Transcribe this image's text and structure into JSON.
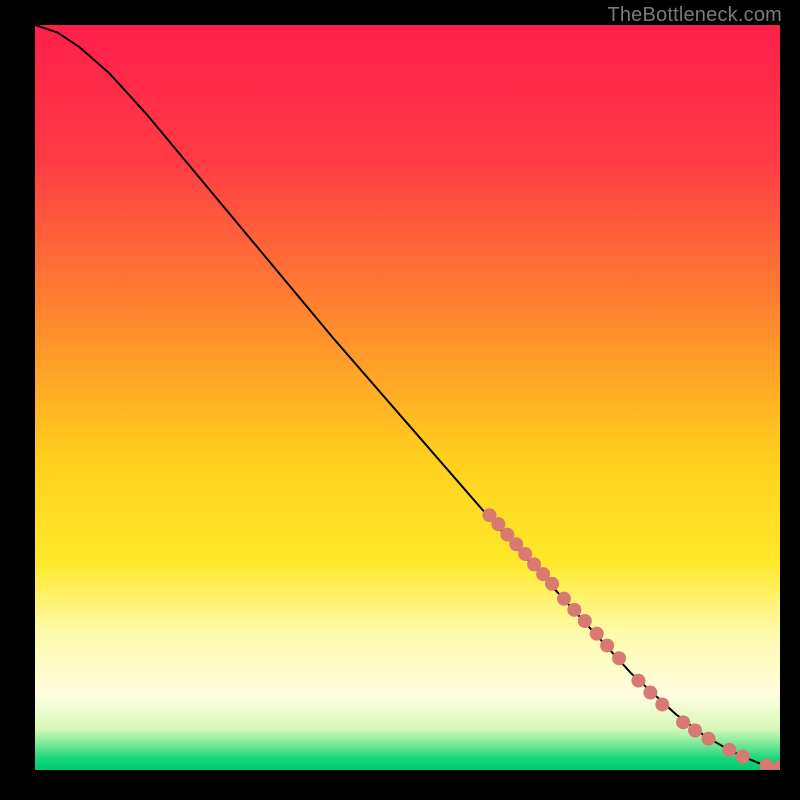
{
  "watermark": "TheBottleneck.com",
  "chart_data": {
    "type": "line",
    "title": "",
    "xlabel": "",
    "ylabel": "",
    "xlim": [
      0,
      100
    ],
    "ylim": [
      0,
      100
    ],
    "gradient_stops": [
      {
        "offset": 0.0,
        "color": "#ff1f4b"
      },
      {
        "offset": 0.18,
        "color": "#ff3b45"
      },
      {
        "offset": 0.4,
        "color": "#ff8a2d"
      },
      {
        "offset": 0.58,
        "color": "#ffcf1e"
      },
      {
        "offset": 0.72,
        "color": "#ffe92a"
      },
      {
        "offset": 0.82,
        "color": "#fffbb0"
      },
      {
        "offset": 0.9,
        "color": "#fffde0"
      },
      {
        "offset": 0.945,
        "color": "#d6f8b8"
      },
      {
        "offset": 0.965,
        "color": "#7ae89a"
      },
      {
        "offset": 0.985,
        "color": "#17d67a"
      },
      {
        "offset": 1.0,
        "color": "#00c96f"
      }
    ],
    "series": [
      {
        "name": "bottleneck-curve",
        "x": [
          0,
          3,
          6,
          10,
          15,
          20,
          30,
          40,
          50,
          60,
          70,
          80,
          86,
          90,
          93,
          95,
          97,
          98.5,
          100
        ],
        "y": [
          100,
          99,
          97,
          93.5,
          88,
          82,
          70,
          58,
          46.5,
          35,
          24,
          13,
          7.5,
          4.5,
          2.8,
          1.8,
          1.0,
          0.5,
          0.4
        ]
      }
    ],
    "markers": {
      "name": "highlight-points",
      "color": "#d97a72",
      "radius": 7,
      "points": [
        {
          "x": 61.0,
          "y": 34.2
        },
        {
          "x": 62.2,
          "y": 33.0
        },
        {
          "x": 63.4,
          "y": 31.6
        },
        {
          "x": 64.6,
          "y": 30.3
        },
        {
          "x": 65.8,
          "y": 29.0
        },
        {
          "x": 67.0,
          "y": 27.6
        },
        {
          "x": 68.2,
          "y": 26.3
        },
        {
          "x": 69.4,
          "y": 25.0
        },
        {
          "x": 71.0,
          "y": 23.0
        },
        {
          "x": 72.4,
          "y": 21.5
        },
        {
          "x": 73.8,
          "y": 20.0
        },
        {
          "x": 75.4,
          "y": 18.3
        },
        {
          "x": 76.8,
          "y": 16.7
        },
        {
          "x": 78.4,
          "y": 15.0
        },
        {
          "x": 81.0,
          "y": 12.0
        },
        {
          "x": 82.6,
          "y": 10.4
        },
        {
          "x": 84.2,
          "y": 8.8
        },
        {
          "x": 87.0,
          "y": 6.4
        },
        {
          "x": 88.6,
          "y": 5.3
        },
        {
          "x": 90.4,
          "y": 4.2
        },
        {
          "x": 93.2,
          "y": 2.7
        },
        {
          "x": 95.0,
          "y": 1.8
        },
        {
          "x": 98.2,
          "y": 0.6
        },
        {
          "x": 100.0,
          "y": 0.4
        }
      ]
    }
  }
}
